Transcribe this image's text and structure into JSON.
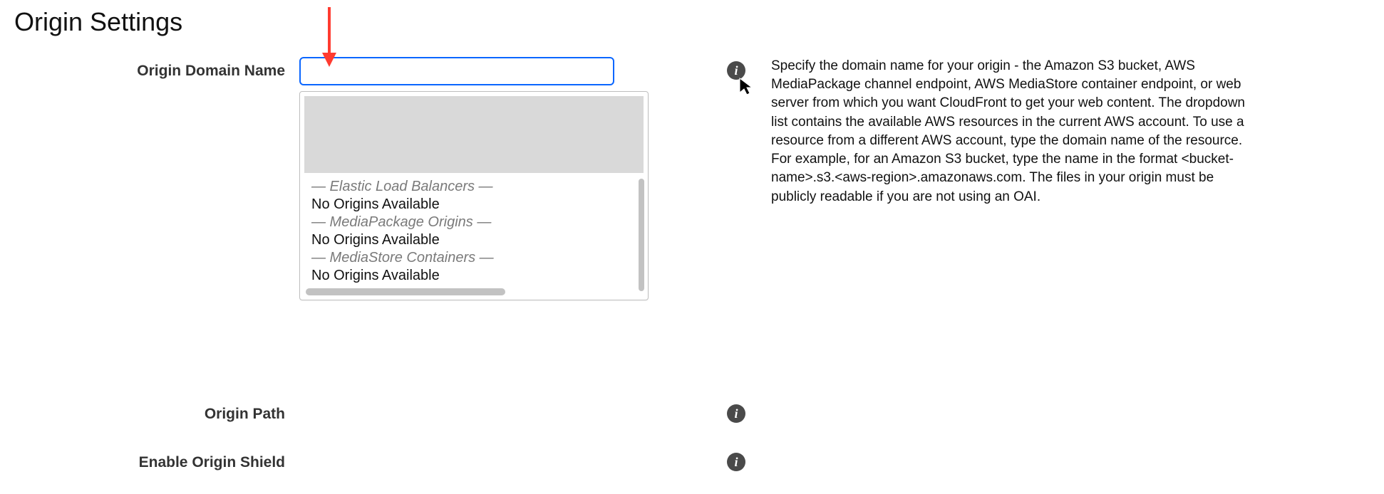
{
  "page": {
    "title": "Origin Settings"
  },
  "form": {
    "originDomainName": {
      "label": "Origin Domain Name",
      "value": "",
      "placeholder": ""
    },
    "originPath": {
      "label": "Origin Path"
    },
    "enableOriginShield": {
      "label": "Enable Origin Shield"
    }
  },
  "dropdown": {
    "groups": [
      {
        "heading": "— Elastic Load Balancers —",
        "item": "No Origins Available"
      },
      {
        "heading": "— MediaPackage Origins —",
        "item": "No Origins Available"
      },
      {
        "heading": "— MediaStore Containers —",
        "item": "No Origins Available"
      }
    ]
  },
  "help": {
    "originDomainName": "Specify the domain name for your origin - the Amazon S3 bucket, AWS MediaPackage channel endpoint, AWS MediaStore container endpoint, or web server from which you want CloudFront to get your web content. The dropdown list contains the available AWS resources in the current AWS account. To use a resource from a different AWS account, type the domain name of the resource. For example, for an Amazon S3 bucket, type the name in the format <bucket-name>.s3.<aws-region>.amazonaws.com. The files in your origin must be publicly readable if you are not using an OAI."
  },
  "icons": {
    "info_glyph": "i"
  }
}
